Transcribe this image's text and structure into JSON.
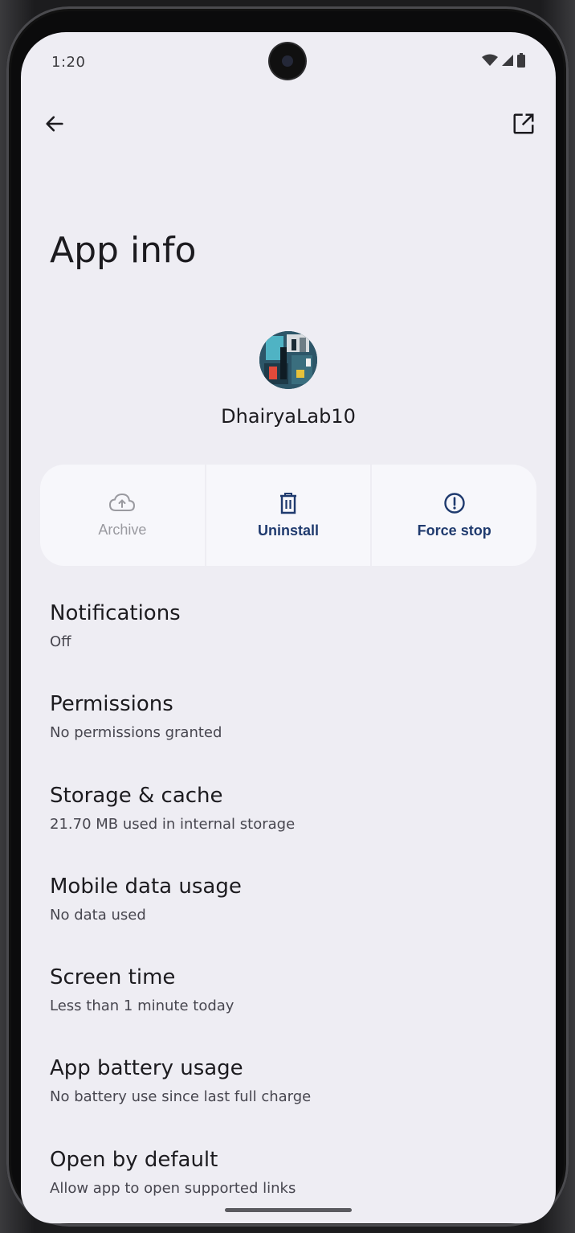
{
  "status_bar": {
    "time": "1:20",
    "icons": [
      "wifi-icon",
      "cell-signal-icon",
      "battery-icon"
    ]
  },
  "toolbar": {
    "back_icon": "arrow-left-icon",
    "open_icon": "open-in-new-icon"
  },
  "page": {
    "title": "App info"
  },
  "app": {
    "name": "DhairyaLab10"
  },
  "actions": [
    {
      "label": "Archive",
      "icon": "cloud-upload-icon",
      "enabled": false
    },
    {
      "label": "Uninstall",
      "icon": "trash-icon",
      "enabled": true
    },
    {
      "label": "Force stop",
      "icon": "alert-circle-icon",
      "enabled": true
    }
  ],
  "settings": [
    {
      "title": "Notifications",
      "summary": "Off"
    },
    {
      "title": "Permissions",
      "summary": "No permissions granted"
    },
    {
      "title": "Storage & cache",
      "summary": "21.70 MB used in internal storage"
    },
    {
      "title": "Mobile data usage",
      "summary": "No data used"
    },
    {
      "title": "Screen time",
      "summary": "Less than 1 minute today"
    },
    {
      "title": "App battery usage",
      "summary": "No battery use since last full charge"
    },
    {
      "title": "Open by default",
      "summary": "Allow app to open supported links"
    }
  ],
  "colors": {
    "background": "#eeedf3",
    "card": "#f7f7fb",
    "accent": "#1f3a6e",
    "disabled": "#9a9aa0",
    "text_primary": "#1c1b1f",
    "text_secondary": "#47464f"
  }
}
